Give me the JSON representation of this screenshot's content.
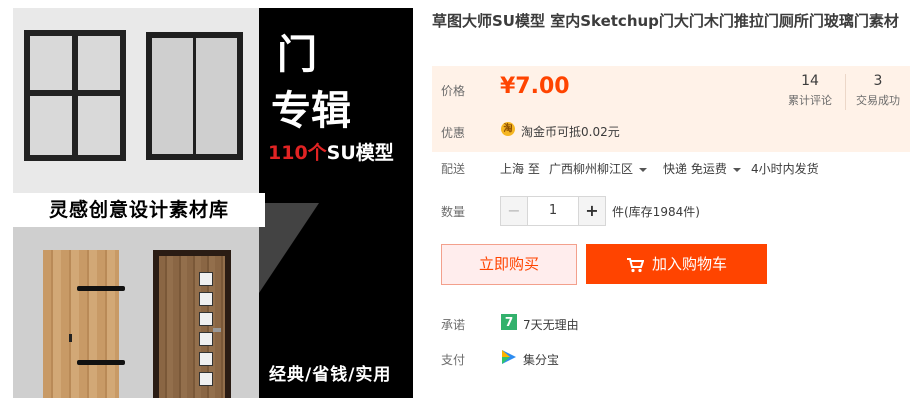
{
  "image": {
    "big_char_1": "门",
    "big_char_2": "专辑",
    "count_number": "110个",
    "count_suffix": "SU模型",
    "banner": "灵感创意设计素材库",
    "slogan": "经典/省钱/实用"
  },
  "product": {
    "title": "草图大师SU模型 室内Sketchup门大门木门推拉门厕所门玻璃门素材"
  },
  "price": {
    "label": "价格",
    "value": "¥7.00",
    "reviews_count": "14",
    "reviews_label": "累计评论",
    "sales_count": "3",
    "sales_label": "交易成功"
  },
  "promo": {
    "label": "优惠",
    "coin_icon_text": "淘",
    "text": "淘金币可抵0.02元"
  },
  "shipping": {
    "label": "配送",
    "from": "上海 至",
    "to": "广西柳州柳江区",
    "method": "快递 免运费",
    "delivery": "4小时内发货"
  },
  "quantity": {
    "label": "数量",
    "minus": "−",
    "value": "1",
    "plus": "+",
    "stock": "件(库存1984件)"
  },
  "actions": {
    "buy_now": "立即购买",
    "add_to_cart": "加入购物车"
  },
  "guarantee": {
    "label": "承诺",
    "badge": "7",
    "text": "7天无理由"
  },
  "payment": {
    "label": "支付",
    "text": "集分宝"
  },
  "colors": {
    "accent": "#ff4400",
    "price_bg": "#fff2e8",
    "guarantee_green": "#32b16c"
  }
}
